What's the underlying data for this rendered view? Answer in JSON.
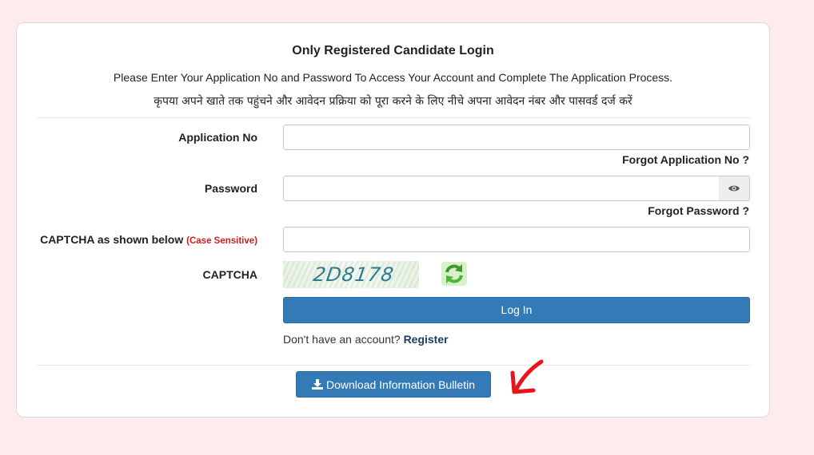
{
  "header": {
    "title": "Only Registered Candidate Login",
    "subtitle_en": "Please Enter Your Application No and Password To Access Your Account and Complete The Application Process.",
    "subtitle_hi": "कृपया अपने खाते तक पहुंचने और आवेदन प्रक्रिया को पूरा करने के लिए नीचे अपना आवेदन नंबर और पासवर्ड दर्ज करें"
  },
  "form": {
    "application_no": {
      "label": "Application No",
      "value": "",
      "placeholder": "",
      "forgot_link": "Forgot Application No ?"
    },
    "password": {
      "label": "Password",
      "value": "",
      "placeholder": "",
      "forgot_link": "Forgot Password ?",
      "toggle_icon": "eye-icon"
    },
    "captcha_input": {
      "label": "CAPTCHA as shown below",
      "hint": "(Case Sensitive)",
      "value": "",
      "placeholder": ""
    },
    "captcha": {
      "label": "CAPTCHA",
      "text": "2D8178",
      "refresh_icon": "refresh-icon"
    },
    "login_button": "Log In",
    "register_prompt": "Don't have an account?",
    "register_link": "Register"
  },
  "footer": {
    "download_button": "Download Information Bulletin",
    "download_icon": "download-icon"
  },
  "colors": {
    "page_background": "#fdeceb",
    "primary_button": "#337ab7",
    "hint_red": "#d21d1d",
    "annotation_arrow": "#e8141c"
  }
}
